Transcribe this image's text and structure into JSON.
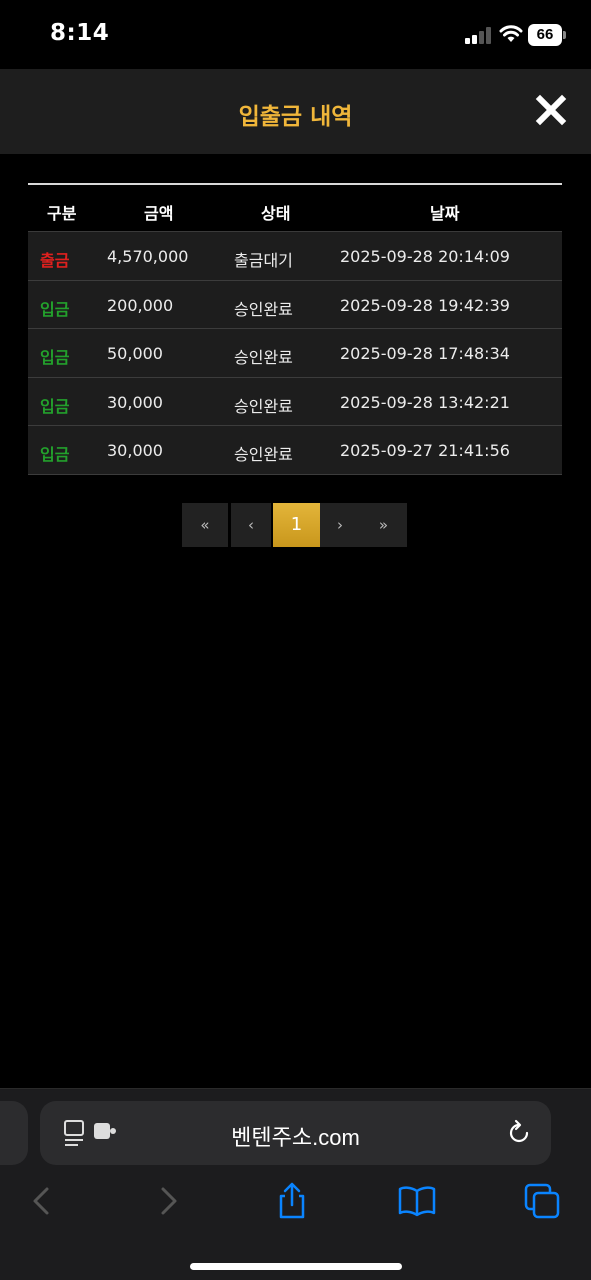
{
  "status_bar": {
    "time": "8:14",
    "battery": "66"
  },
  "modal": {
    "title": "입출금 내역",
    "close_icon": "close-icon"
  },
  "table": {
    "headers": [
      "구분",
      "금액",
      "상태",
      "날짜"
    ],
    "rows": [
      {
        "type": "출금",
        "type_kind": "withdraw",
        "amount": "4,570,000",
        "status": "출금대기",
        "date": "2025-09-28 20:14:09"
      },
      {
        "type": "입금",
        "type_kind": "deposit",
        "amount": "200,000",
        "status": "승인완료",
        "date": "2025-09-28 19:42:39"
      },
      {
        "type": "입금",
        "type_kind": "deposit",
        "amount": "50,000",
        "status": "승인완료",
        "date": "2025-09-28 17:48:34"
      },
      {
        "type": "입금",
        "type_kind": "deposit",
        "amount": "30,000",
        "status": "승인완료",
        "date": "2025-09-28 13:42:21"
      },
      {
        "type": "입금",
        "type_kind": "deposit",
        "amount": "30,000",
        "status": "승인완료",
        "date": "2025-09-27 21:41:56"
      }
    ]
  },
  "pagination": {
    "first": "«",
    "prev": "‹",
    "current": "1",
    "next": "›",
    "last": "»"
  },
  "browser": {
    "url": "벤텐주소.com"
  },
  "colors": {
    "accent": "#f0b63a",
    "withdraw": "#e0201e",
    "deposit": "#23a02c",
    "ios_blue": "#0a84ff"
  }
}
